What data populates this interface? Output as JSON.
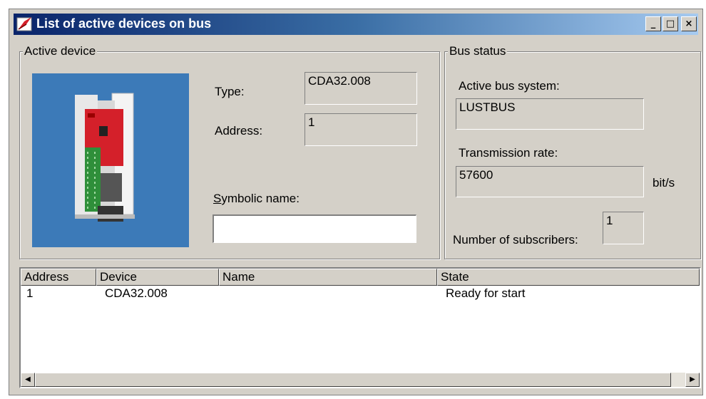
{
  "window": {
    "title": "List of active devices on bus",
    "controls": {
      "minimize": "_",
      "maximize": "□",
      "close": "×"
    }
  },
  "active_device": {
    "legend": "Active device",
    "image_label": "device-photo",
    "type_label": "Type:",
    "type_value": "CDA32.008",
    "address_label": "Address:",
    "address_value": "1",
    "symbolic_name_accel": "S",
    "symbolic_name_rest": "ymbolic name:",
    "symbolic_name_value": ""
  },
  "bus_status": {
    "legend": "Bus status",
    "active_bus_label": "Active bus system:",
    "active_bus_value": "LUSTBUS",
    "rate_label": "Transmission rate:",
    "rate_value": "57600",
    "rate_unit": "bit/s",
    "subscribers_label": "Number of subscribers:",
    "subscribers_value": "1"
  },
  "device_list": {
    "columns": [
      "Address",
      "Device",
      "Name",
      "State"
    ],
    "rows": [
      {
        "address": "1",
        "device": "CDA32.008",
        "name": "",
        "state": "Ready for start"
      }
    ]
  },
  "colors": {
    "window_face": "#d4d0c8",
    "title_start": "#0a246a",
    "title_end": "#a6caf0",
    "image_bg": "#3c7ab8",
    "device_red": "#d4202a"
  }
}
